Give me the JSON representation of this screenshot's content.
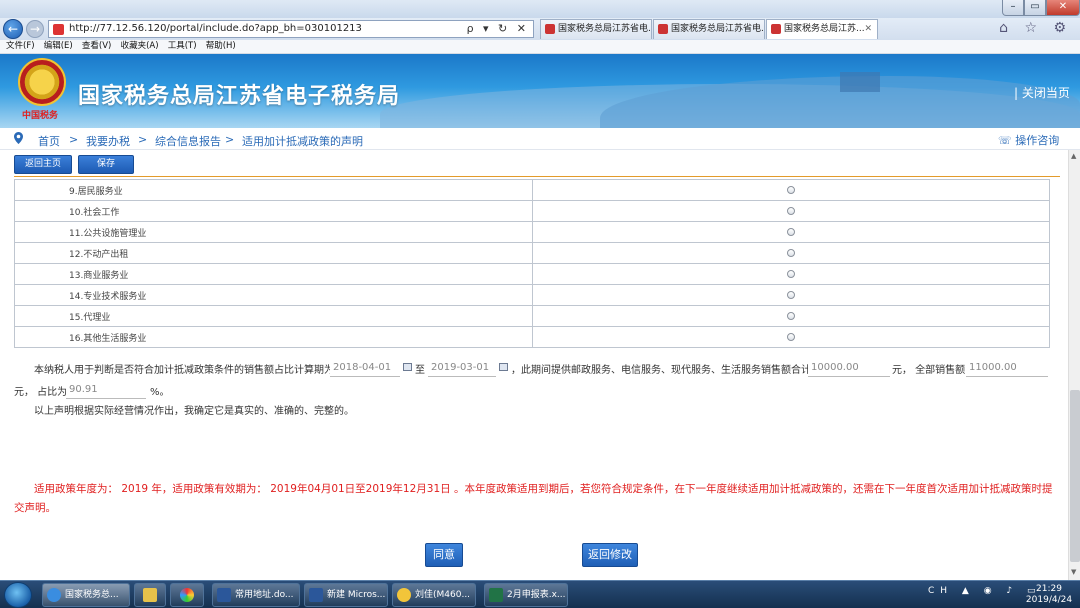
{
  "browser": {
    "url": "http://77.12.56.120/portal/include.do?app_bh=030101213",
    "url_tools": "ρ ▾ ↻ ✕",
    "tabs": [
      "国家税务总局江苏省电...",
      "国家税务总局江苏省电...",
      "国家税务总局江苏..."
    ],
    "menu": [
      "文件(F)",
      "编辑(E)",
      "查看(V)",
      "收藏夹(A)",
      "工具(T)",
      "帮助(H)"
    ],
    "right_tools": "⌂ ☆ ⚙"
  },
  "header": {
    "emblem_caption": "中国税务",
    "title": "国家税务总局江苏省电子税务局",
    "close_link": "| 关闭当页"
  },
  "breadcrumb": {
    "items": [
      "首页",
      "我要办税",
      "综合信息报告",
      "适用加计抵减政策的声明"
    ],
    "separator": ">",
    "help": "操作咨询"
  },
  "toolbar": {
    "home_label": "返回主页",
    "save_label": "保存"
  },
  "industries": [
    "9.居民服务业",
    "10.社会工作",
    "11.公共设施管理业",
    "12.不动产出租",
    "13.商业服务业",
    "14.专业技术服务业",
    "15.代理业",
    "16.其他生活服务业"
  ],
  "declaration": {
    "prefix": "本纳税人用于判断是否符合加计抵减政策条件的销售额占比计算期为",
    "start_date": "2018-04-01",
    "to": "至",
    "end_date": "2019-03-01",
    "mid": "，此期间提供邮政服务、电信服务、现代服务、生活服务销售额合计",
    "service_sales": "10000.00",
    "unit_total_prefix": "元， 全部销售额",
    "total_sales": "11000.00",
    "ratio_prefix": "元， 占比为",
    "ratio": "90.91",
    "percent": "%。",
    "statement": "以上声明根据实际经营情况作出，我确定它是真实的、准确的、完整的。"
  },
  "notice": "适用政策年度为： 2019  年，适用政策有效期为： 2019年04月01日至2019年12月31日 。本年度政策适用到期后，若您符合规定条件，在下一年度继续适用加计抵减政策的，还需在下一年度首次适用加计抵减政策时提交声明。",
  "actions": {
    "agree": "同意",
    "back_modify": "返回修改"
  },
  "taskbar": {
    "tasks": [
      "国家税务总...",
      "",
      "",
      "常用地址.do...",
      "新建 Micros...",
      "刘佳(M460...",
      "2月申报表.x..."
    ],
    "tray": "CH ▲ ◉ ♪ ▭",
    "time": "21:29",
    "date": "2019/4/24"
  },
  "colors": {
    "accent_blue": "#1d5bb3",
    "notice_red": "#e02020",
    "link_blue": "#2a6ab7"
  }
}
